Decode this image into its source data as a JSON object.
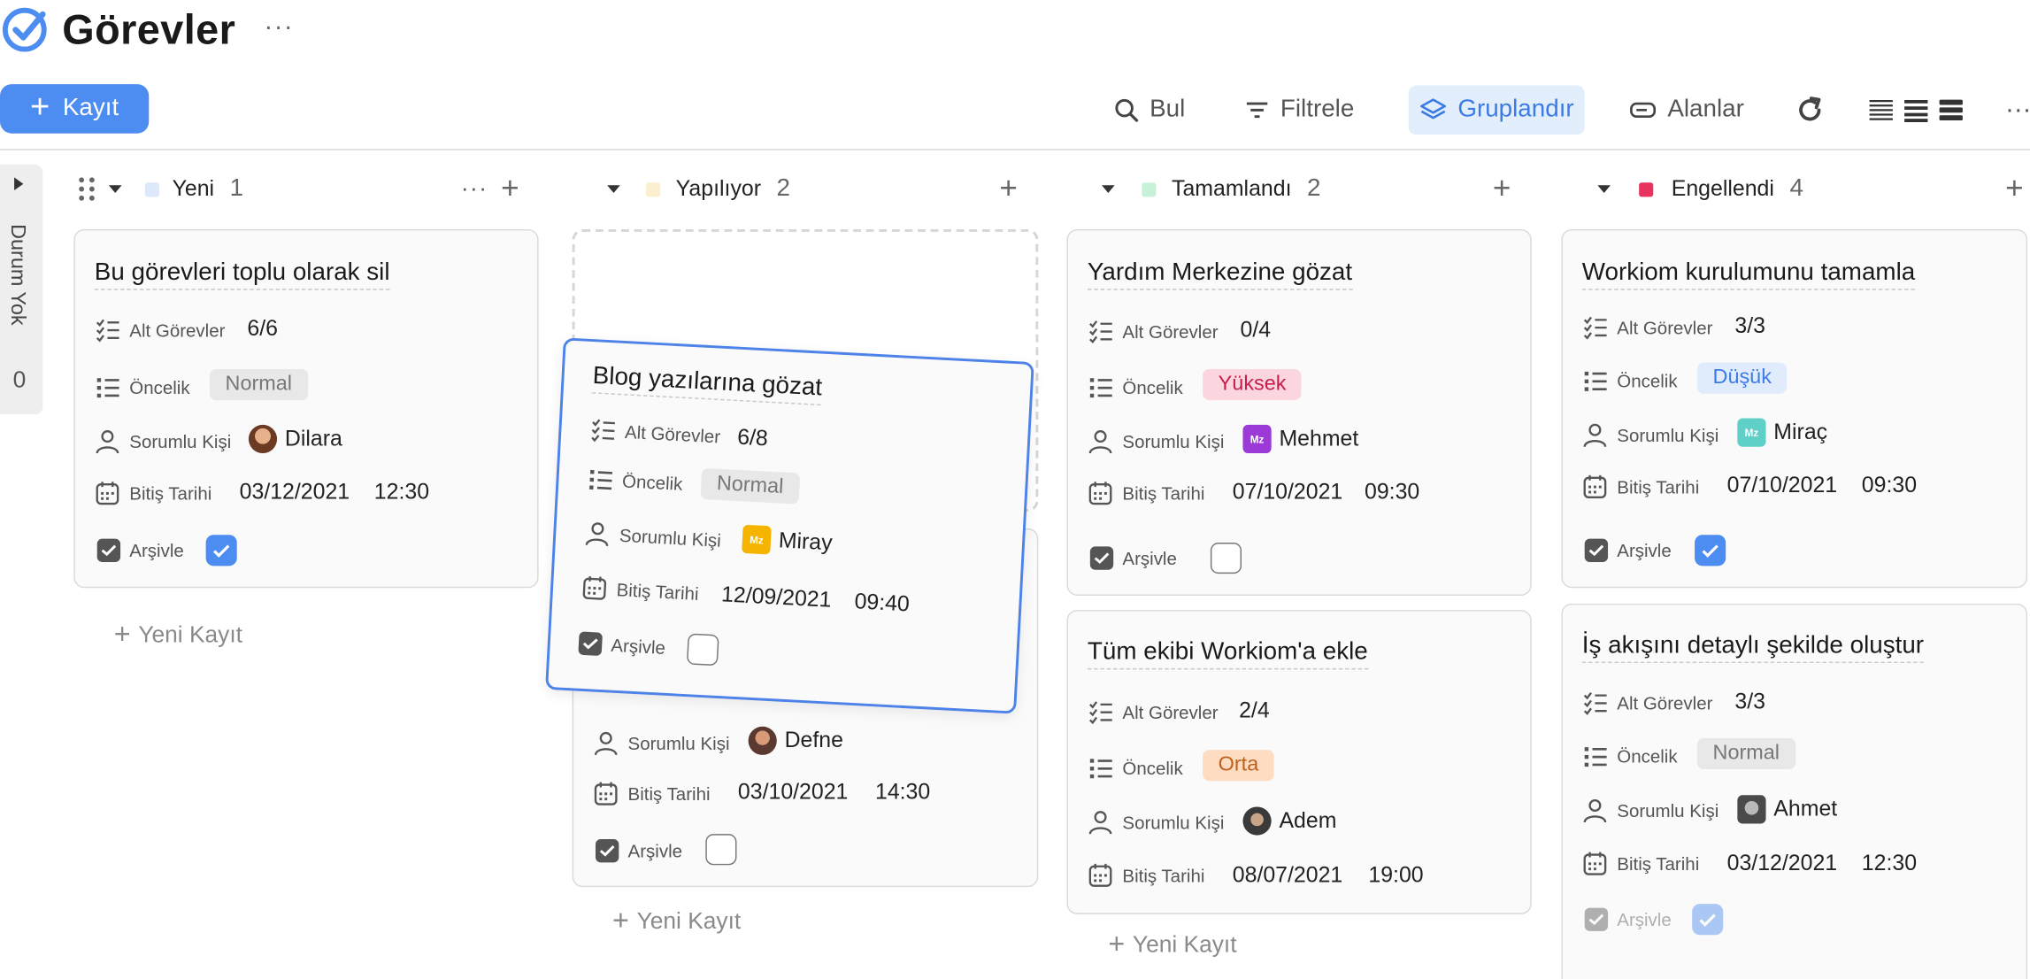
{
  "app": {
    "title": "Görevler",
    "more": "···"
  },
  "toolbar": {
    "new_label": "Kayıt",
    "find_label": "Bul",
    "filter_label": "Filtrele",
    "group_label": "Gruplandır",
    "fields_label": "Alanlar",
    "more": "···"
  },
  "sidebar": {
    "label": "Durum Yok",
    "count": "0"
  },
  "labels": {
    "subtasks": "Alt Görevler",
    "priority": "Öncelik",
    "assignee": "Sorumlu Kişi",
    "due": "Bitiş Tarihi",
    "archive": "Arşivle",
    "add_record": "Yeni Kayıt"
  },
  "columns": [
    {
      "name": "Yeni",
      "count": "1",
      "color": "#dbe9fb"
    },
    {
      "name": "Yapılıyor",
      "count": "2",
      "color": "#fbefcf"
    },
    {
      "name": "Tamamlandı",
      "count": "2",
      "color": "#c8f2d8"
    },
    {
      "name": "Engellendi",
      "count": "4",
      "color": "#e8335f"
    }
  ],
  "cards": [
    {
      "title": "Bu görevleri toplu olarak sil",
      "subtasks": "6/6",
      "priority": "Normal",
      "assignee": "Dilara",
      "date": "03/12/2021",
      "time": "12:30",
      "archived": true
    },
    {
      "title": "Blog yazılarına gözat",
      "subtasks": "6/8",
      "priority": "Normal",
      "assignee": "Miray",
      "avatar_text": "Mz",
      "date": "12/09/2021",
      "time": "09:40",
      "archived": false
    },
    {
      "title": "",
      "subtasks": "",
      "priority": "",
      "assignee": "Defne",
      "date": "03/10/2021",
      "time": "14:30",
      "archived": false
    },
    {
      "title": "Yardım Merkezine gözat",
      "subtasks": "0/4",
      "priority": "Yüksek",
      "assignee": "Mehmet",
      "avatar_text": "Mz",
      "date": "07/10/2021",
      "time": "09:30",
      "archived": false
    },
    {
      "title": "Tüm ekibi Workiom'a ekle",
      "subtasks": "2/4",
      "priority": "Orta",
      "assignee": "Adem",
      "date": "08/07/2021",
      "time": "19:00",
      "archived": false
    },
    {
      "title": "Workiom kurulumunu tamamla",
      "subtasks": "3/3",
      "priority": "Düşük",
      "assignee": "Miraç",
      "avatar_text": "Mz",
      "date": "07/10/2021",
      "time": "09:30",
      "archived": true
    },
    {
      "title": "İş akışını detaylı şekilde oluştur",
      "subtasks": "3/3",
      "priority": "Normal",
      "assignee": "Ahmet",
      "date": "03/12/2021",
      "time": "12:30",
      "archived": true
    }
  ],
  "colors": {
    "accent": "#4d8cf0",
    "drag_border": "#4d82e8"
  }
}
